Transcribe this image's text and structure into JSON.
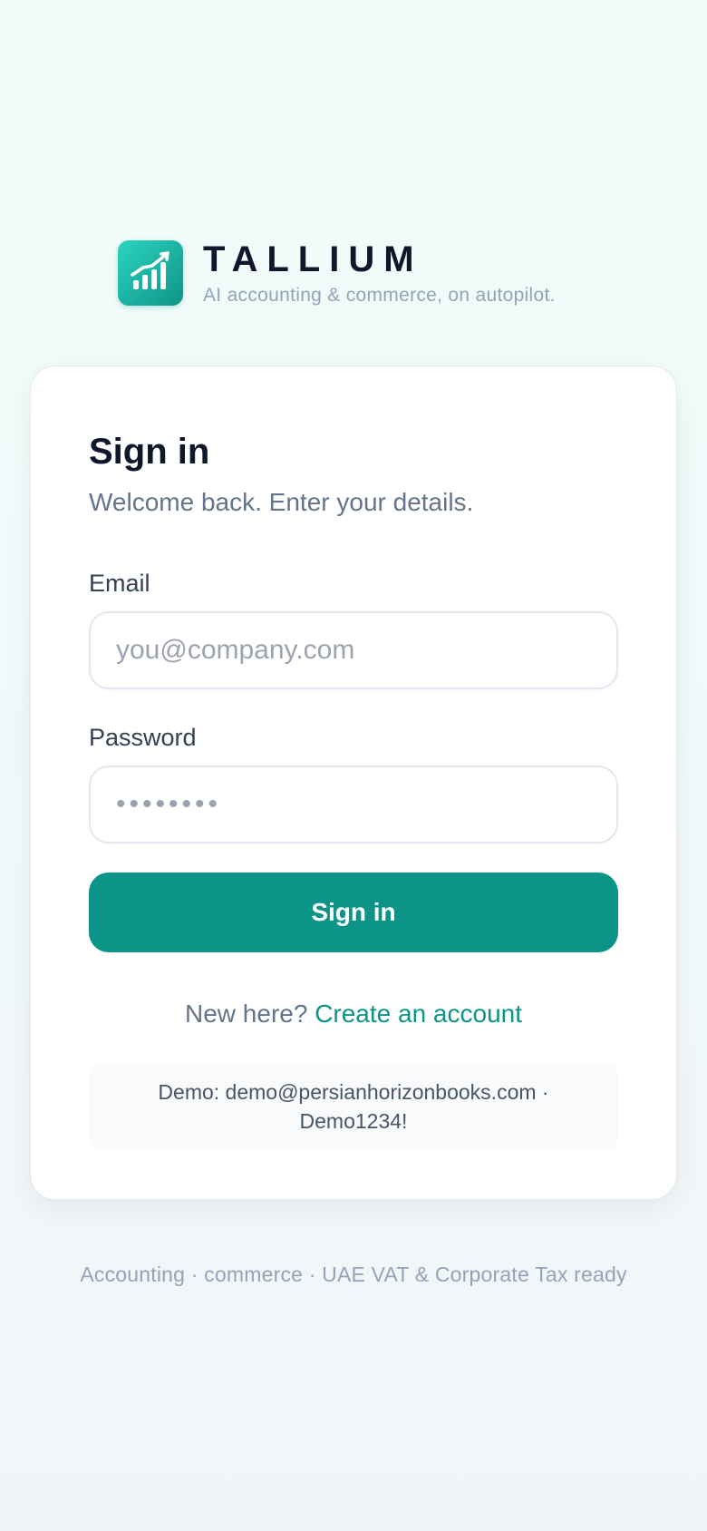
{
  "brand": {
    "logo_icon": "trending-up-bars-icon",
    "name": "TALLIUM",
    "tagline": "AI accounting & commerce, on autopilot."
  },
  "card": {
    "title": "Sign in",
    "subtitle": "Welcome back. Enter your details.",
    "email": {
      "label": "Email",
      "value": "",
      "placeholder": "you@company.com"
    },
    "password": {
      "label": "Password",
      "value": "",
      "placeholder": "••••••••"
    },
    "submit_label": "Sign in",
    "register": {
      "prompt": "New here?",
      "link_label": "Create an account"
    },
    "demo": {
      "text": "Demo: demo@persianhorizonbooks.com · Demo1234!"
    }
  },
  "footer": {
    "text": "Accounting · commerce · UAE VAT & Corporate Tax ready"
  },
  "colors": {
    "accent": "#0d9488",
    "accent_light": "#2dd4bf",
    "text_primary": "#0f172a",
    "text_muted": "#64748b"
  }
}
